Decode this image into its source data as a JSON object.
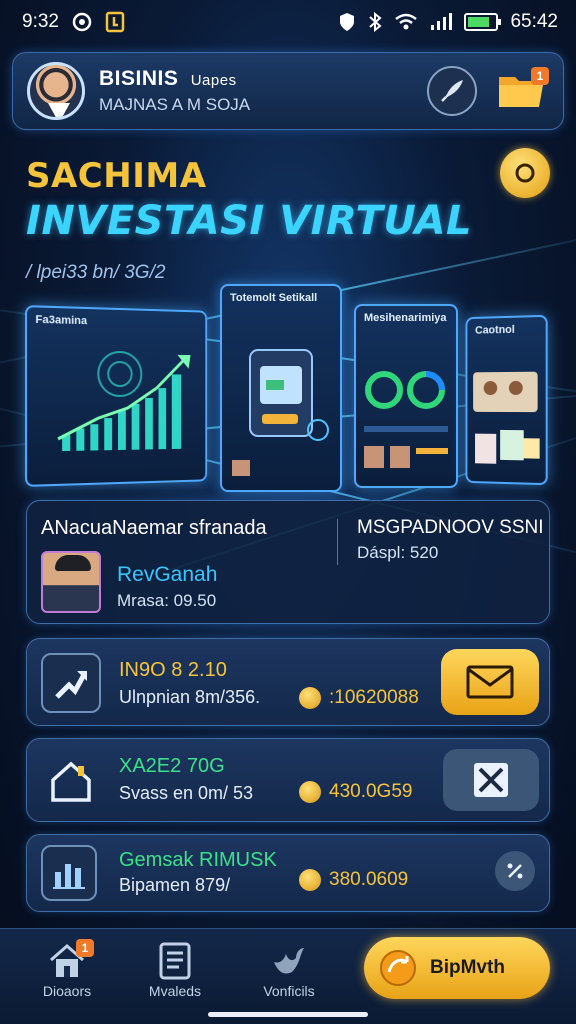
{
  "status_bar": {
    "time_left": "9:32",
    "time_right": "65:42"
  },
  "header": {
    "title": "BISINIS",
    "title_suffix": "Uapes",
    "subtitle": "MAJNAS A M SOJA",
    "folder_badge": "1"
  },
  "hero": {
    "kicker": "SACHIMA",
    "title": "INVESTASI VIRTUAL",
    "subtitle": "/ lpei33 bn/ 3G/2"
  },
  "panels": [
    {
      "title": "Fa3amina"
    },
    {
      "title": "Totemolt Setikall"
    },
    {
      "title": "Mesihenarimiya"
    },
    {
      "title": "Caotnol"
    }
  ],
  "profile": {
    "title": "ANacuaNaemar sfranada",
    "right_title": "MSGPADNOOV SSNI",
    "right_subtitle": "Dáspl: 520",
    "name": "RevGanah",
    "meta": "Mrasa: 09.50"
  },
  "items": [
    {
      "name": "IN9O 8 2.10",
      "sub": "Ulnpnian 8m/356.",
      "amount": ":10620088",
      "action_icon": "mail-icon"
    },
    {
      "name": "XA2E2 70G",
      "sub": "Svass en 0m/ 53",
      "amount": "430.0G59",
      "action_icon": "close-icon"
    },
    {
      "name": "Gemsak RIMUSK",
      "sub": "Bipamen 879/",
      "amount": "380.0609",
      "action_icon": "percent-icon"
    }
  ],
  "bottom_nav": {
    "items": [
      {
        "label": "Dioaors",
        "icon": "home-icon",
        "badge": "1"
      },
      {
        "label": "Mvaleds",
        "icon": "notes-icon"
      },
      {
        "label": "Vonficils",
        "icon": "bird-icon"
      }
    ],
    "cta_label": "BipMvth"
  },
  "colors": {
    "accent_gold": "#f6c43a",
    "accent_cyan": "#3bd4ff",
    "background": "#0a1a36"
  }
}
